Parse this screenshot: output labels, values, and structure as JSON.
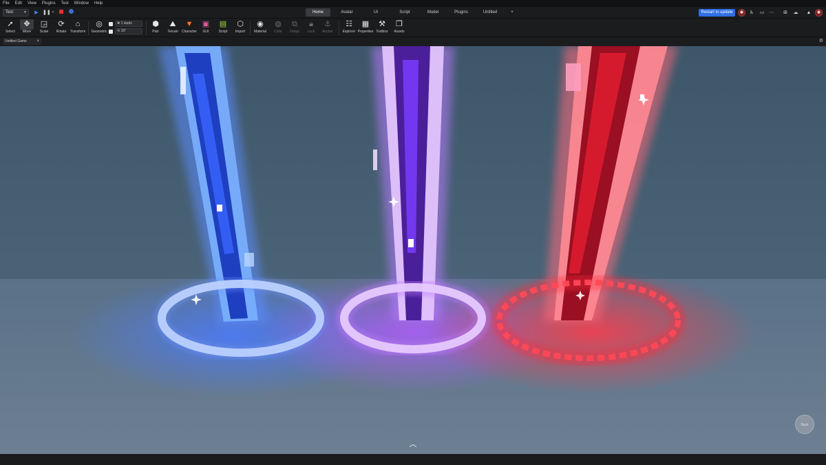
{
  "menu": [
    "File",
    "Edit",
    "View",
    "Plugins",
    "Test",
    "Window",
    "Help"
  ],
  "play_controls": {
    "mode_value": "Test",
    "play_icon": "play-icon",
    "pause_icon": "pause-icon",
    "stop_icon": "stop-icon",
    "teamtest_icon": "team-test-icon"
  },
  "tabs": [
    "Home",
    "Avatar",
    "UI",
    "Script",
    "Model",
    "Plugins",
    "Untitled"
  ],
  "active_tab": "Home",
  "add_tab_label": "+",
  "restart_label": "Restart to update",
  "ribbon": {
    "tools": [
      "Select",
      "Move",
      "Scale",
      "Rotate",
      "Transform"
    ],
    "active_tool": "Move",
    "geometric_label": "Geometric",
    "snap_move_value": "1 studs",
    "snap_rotate_value": "15°",
    "insert": [
      "Part",
      "Terrain",
      "Character",
      "GUI",
      "Script",
      "Import"
    ],
    "edit": [
      "Material",
      "Color",
      "Group",
      "Lock",
      "Anchor"
    ],
    "windows": [
      "Explorer",
      "Properties",
      "Toolbox",
      "Assets"
    ]
  },
  "doc_tab": {
    "label": "Untitled Game"
  },
  "viewport": {
    "back_label": "Back",
    "up_icon": "chevron-up-icon"
  },
  "colors": {
    "accent": "#2f6fe4",
    "beam_blue": "#3a6bff",
    "beam_purple": "#8a3cff",
    "beam_red": "#ff2a3a"
  }
}
